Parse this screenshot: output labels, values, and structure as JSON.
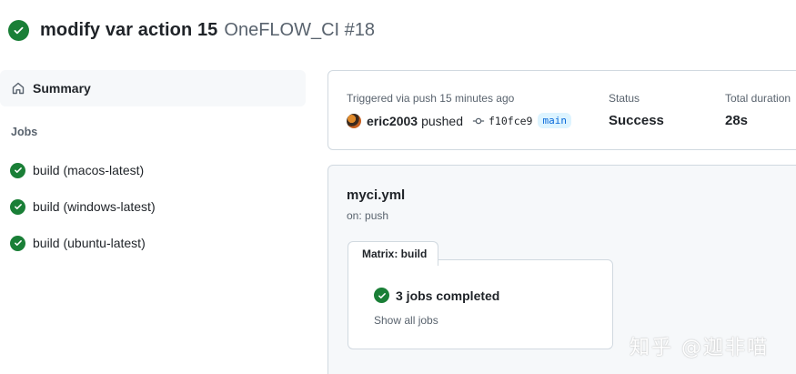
{
  "header": {
    "run_title": "modify var action 15",
    "workflow_name": "OneFLOW_CI #18"
  },
  "sidebar": {
    "summary_label": "Summary",
    "jobs_heading": "Jobs",
    "jobs": [
      {
        "label": "build (macos-latest)"
      },
      {
        "label": "build (windows-latest)"
      },
      {
        "label": "build (ubuntu-latest)"
      }
    ]
  },
  "summary": {
    "trigger_text": "Triggered via push 15 minutes ago",
    "actor": "eric2003",
    "action": "pushed",
    "commit_sha": "f10fce9",
    "branch": "main",
    "status_label": "Status",
    "status_value": "Success",
    "duration_label": "Total duration",
    "duration_value": "28s"
  },
  "workflow": {
    "file": "myci.yml",
    "on": "on: push",
    "matrix_label": "Matrix: build",
    "matrix_status": "3 jobs completed",
    "show_all": "Show all jobs"
  },
  "watermark": "知乎 @迦非喵",
  "colors": {
    "success": "#1a7f37",
    "muted_text": "#59636e",
    "accent": "#0969da"
  }
}
